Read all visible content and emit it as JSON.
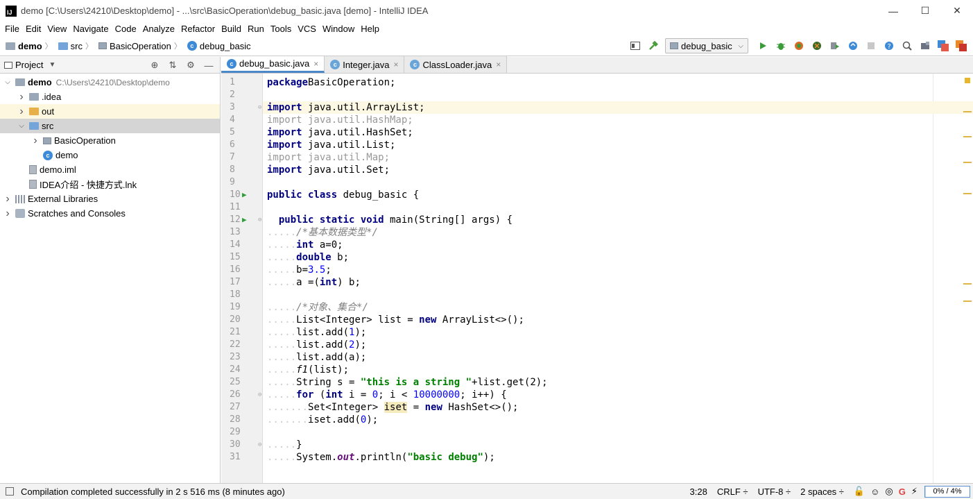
{
  "window": {
    "logo_text": "IJ",
    "title": "demo [C:\\Users\\24210\\Desktop\\demo] - ...\\src\\BasicOperation\\debug_basic.java [demo] - IntelliJ IDEA",
    "minimize": "—",
    "maximize": "☐",
    "close": "✕"
  },
  "menu": [
    "File",
    "Edit",
    "View",
    "Navigate",
    "Code",
    "Analyze",
    "Refactor",
    "Build",
    "Run",
    "Tools",
    "VCS",
    "Window",
    "Help"
  ],
  "breadcrumb": [
    "demo",
    "src",
    "BasicOperation",
    "debug_basic"
  ],
  "toolbar": {
    "run_config": "debug_basic"
  },
  "project_panel": {
    "title": "Project",
    "tree": [
      {
        "label": "demo",
        "extra": "C:\\Users\\24210\\Desktop\\demo",
        "level": 0,
        "arrow": "open",
        "icon": "folder",
        "bold": true
      },
      {
        "label": ".idea",
        "level": 1,
        "arrow": "closed",
        "icon": "folder"
      },
      {
        "label": "out",
        "level": 1,
        "arrow": "closed",
        "icon": "folder-orange",
        "state": "hl"
      },
      {
        "label": "src",
        "level": 1,
        "arrow": "open",
        "icon": "folder-blue",
        "state": "sel"
      },
      {
        "label": "BasicOperation",
        "level": 2,
        "arrow": "closed",
        "icon": "package"
      },
      {
        "label": "demo",
        "level": 2,
        "arrow": "none",
        "icon": "class"
      },
      {
        "label": "demo.iml",
        "level": 1,
        "arrow": "none",
        "icon": "file"
      },
      {
        "label": "IDEA介绍 - 快捷方式.lnk",
        "level": 1,
        "arrow": "none",
        "icon": "file"
      },
      {
        "label": "External Libraries",
        "level": 0,
        "arrow": "closed",
        "icon": "lib"
      },
      {
        "label": "Scratches and Consoles",
        "level": 0,
        "arrow": "closed",
        "icon": "scratch"
      }
    ]
  },
  "tabs": [
    {
      "label": "debug_basic.java",
      "active": true
    },
    {
      "label": "Integer.java",
      "active": false
    },
    {
      "label": "ClassLoader.java",
      "active": false
    }
  ],
  "code": {
    "current_line": 3,
    "run_markers": [
      10,
      12
    ],
    "fold_markers": [
      3,
      12,
      26,
      30
    ],
    "lines": [
      [
        [
          "kw",
          "package"
        ],
        [
          "",
          "BasicOperation;"
        ]
      ],
      [],
      [
        [
          "kw",
          "import"
        ],
        [
          "",
          " java.util.ArrayList;"
        ]
      ],
      [
        [
          "dim",
          "import java.util.HashMap;"
        ]
      ],
      [
        [
          "kw",
          "import"
        ],
        [
          "",
          " java.util.HashSet;"
        ]
      ],
      [
        [
          "kw",
          "import"
        ],
        [
          "",
          " java.util.List;"
        ]
      ],
      [
        [
          "dim",
          "import java.util.Map;"
        ]
      ],
      [
        [
          "kw",
          "import"
        ],
        [
          "",
          " java.util.Set;"
        ]
      ],
      [],
      [
        [
          "kw",
          "public class"
        ],
        [
          "",
          " debug_basic {"
        ]
      ],
      [],
      [
        [
          "",
          ""
        ],
        [
          "kw",
          "  public static void"
        ],
        [
          "",
          " main(String[] args) {"
        ]
      ],
      [
        [
          "ind",
          "....."
        ],
        [
          "cm",
          "/*基本数据类型*/"
        ]
      ],
      [
        [
          "ind",
          "....."
        ],
        [
          "kw",
          "int"
        ],
        [
          "",
          " a=0;"
        ]
      ],
      [
        [
          "ind",
          "....."
        ],
        [
          "kw",
          "double"
        ],
        [
          "",
          " b;"
        ]
      ],
      [
        [
          "ind",
          "....."
        ],
        [
          "",
          "b="
        ],
        [
          "num",
          "3.5"
        ],
        [
          "",
          ";"
        ]
      ],
      [
        [
          "ind",
          "....."
        ],
        [
          "",
          "a =("
        ],
        [
          "kw",
          "int"
        ],
        [
          "",
          ") b;"
        ]
      ],
      [],
      [
        [
          "ind",
          "....."
        ],
        [
          "cm",
          "/*对象、集合*/"
        ]
      ],
      [
        [
          "ind",
          "....."
        ],
        [
          "",
          "List<Integer> list = "
        ],
        [
          "kw",
          "new"
        ],
        [
          "",
          " ArrayList<>();"
        ]
      ],
      [
        [
          "ind",
          "....."
        ],
        [
          "",
          "list.add("
        ],
        [
          "num",
          "1"
        ],
        [
          "",
          ");"
        ]
      ],
      [
        [
          "ind",
          "....."
        ],
        [
          "",
          "list.add("
        ],
        [
          "num",
          "2"
        ],
        [
          "",
          ");"
        ]
      ],
      [
        [
          "ind",
          "....."
        ],
        [
          "",
          "list.add(a);"
        ]
      ],
      [
        [
          "ind",
          "....."
        ],
        [
          "ital",
          "f1"
        ],
        [
          "",
          "(list);"
        ]
      ],
      [
        [
          "ind",
          "....."
        ],
        [
          "",
          "String s = "
        ],
        [
          "str",
          "\"this is a string \""
        ],
        [
          "",
          "+list.get(2);"
        ]
      ],
      [
        [
          "ind",
          "....."
        ],
        [
          "kw",
          "for"
        ],
        [
          "",
          " ("
        ],
        [
          "kw",
          "int"
        ],
        [
          "",
          " i = "
        ],
        [
          "num",
          "0"
        ],
        [
          "",
          "; i < "
        ],
        [
          "num",
          "10000000"
        ],
        [
          "",
          "; i++) {"
        ]
      ],
      [
        [
          "ind",
          "......."
        ],
        [
          "",
          "Set<Integer> "
        ],
        [
          "hlvar",
          "iset"
        ],
        [
          "",
          " = "
        ],
        [
          "kw",
          "new"
        ],
        [
          "",
          " HashSet<>();"
        ]
      ],
      [
        [
          "ind",
          "......."
        ],
        [
          "",
          "iset.add("
        ],
        [
          "num",
          "0"
        ],
        [
          "",
          ");"
        ]
      ],
      [],
      [
        [
          "ind",
          "....."
        ],
        [
          "",
          "}"
        ]
      ],
      [
        [
          "ind",
          "....."
        ],
        [
          "",
          "System."
        ],
        [
          "fld",
          "out"
        ],
        [
          "",
          ".println("
        ],
        [
          "str",
          "\"basic debug\""
        ],
        [
          "",
          ");"
        ]
      ]
    ]
  },
  "status": {
    "message": "Compilation completed successfully in 2 s 516 ms (8 minutes ago)",
    "position": "3:28",
    "line_sep": "CRLF ÷",
    "encoding": "UTF-8 ÷",
    "indent": "2 spaces ÷",
    "memory": "0% / 4%",
    "memory_fraction": 0.02
  }
}
